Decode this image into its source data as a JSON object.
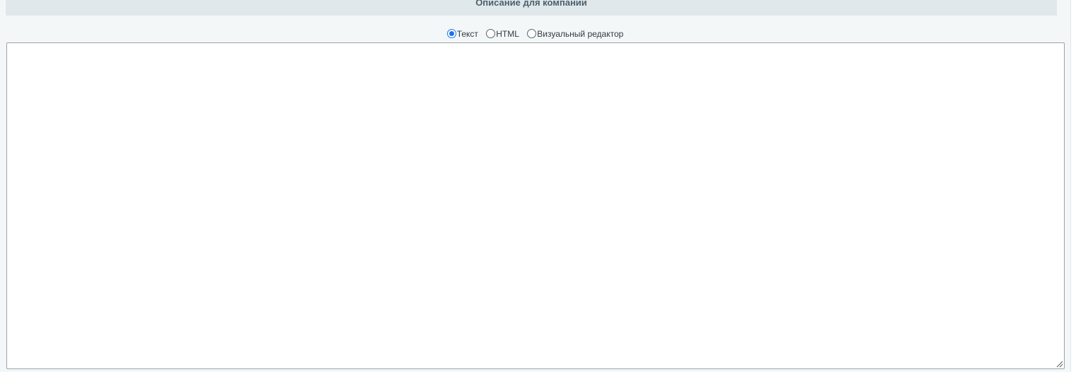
{
  "section": {
    "title": "Описание для компании"
  },
  "mode_switch": {
    "options": [
      {
        "label": "Текст",
        "checked": true
      },
      {
        "label": "HTML",
        "checked": false
      },
      {
        "label": "Визуальный редактор",
        "checked": false
      }
    ]
  },
  "editor": {
    "value": "",
    "placeholder": ""
  },
  "colors": {
    "header_bg": "#e0e8eb",
    "page_bg": "#f4f7f8",
    "title_text": "#4b5f6b",
    "radio_accent": "#1a73e8"
  },
  "icons": {
    "radio_checked": "radio-checked-icon",
    "radio_unchecked": "radio-unchecked-icon",
    "resize_grip": "resize-grip-icon"
  }
}
